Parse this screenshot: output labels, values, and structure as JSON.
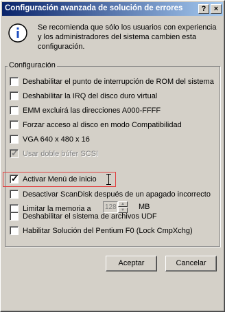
{
  "window": {
    "title": "Configuración avanzada de solución de errores",
    "help_glyph": "?",
    "close_glyph": "×"
  },
  "info": {
    "icon": "info-icon",
    "text": "Se recomienda que sólo los usuarios con experiencia y los administradores del sistema cambien esta configuración."
  },
  "group": {
    "label": "Configuración",
    "options": [
      {
        "label": "Deshabilitar el punto de interrupción de ROM del sistema",
        "checked": false,
        "disabled": false
      },
      {
        "label": "Deshabilitar la IRQ del disco duro virtual",
        "checked": false,
        "disabled": false
      },
      {
        "label": "EMM excluirá las direcciones A000-FFFF",
        "checked": false,
        "disabled": false
      },
      {
        "label": "Forzar acceso al disco en modo Compatibilidad",
        "checked": false,
        "disabled": false
      },
      {
        "label": "VGA 640 x 480 x 16",
        "checked": false,
        "disabled": false
      },
      {
        "label": "Usar doble búfer SCSI",
        "checked": true,
        "disabled": true
      },
      {
        "label": "Activar Menú de inicio",
        "checked": true,
        "disabled": false
      },
      {
        "label": "Desactivar ScanDisk después de un apagado incorrecto",
        "checked": false,
        "disabled": false
      },
      {
        "label": "Limitar la memoria a",
        "checked": false,
        "disabled": false
      },
      {
        "label": "Deshabilitar el sistema de archivos UDF",
        "checked": false,
        "disabled": false
      },
      {
        "label": "Habilitar Solución del Pentium F0 (Lock CmpXchg)",
        "checked": false,
        "disabled": false
      }
    ],
    "memory_value": "128",
    "memory_unit": "MB",
    "check_glyph": "✓"
  },
  "buttons": {
    "accept": "Aceptar",
    "cancel": "Cancelar"
  }
}
